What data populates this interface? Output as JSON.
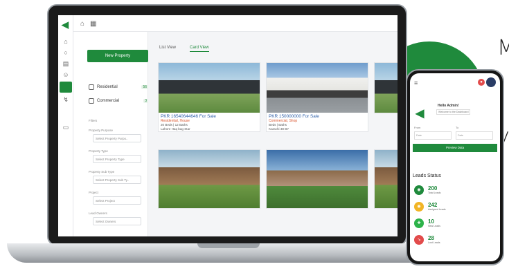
{
  "edge_text": {
    "line1": "M",
    "line2": "y"
  },
  "top_bar": {
    "home_icon": "home-icon",
    "building_icon": "building-icon"
  },
  "filter_panel": {
    "new_property": "New Property",
    "categories": [
      {
        "label": "Residential",
        "count": "56"
      },
      {
        "label": "Commercial",
        "count": "3"
      }
    ],
    "section_label": "Filters",
    "fields": [
      {
        "label": "Property Purpose",
        "placeholder": "Select Property Purpo.."
      },
      {
        "label": "Property Type",
        "placeholder": "Select Property Type"
      },
      {
        "label": "Property Sub Type",
        "placeholder": "Select Property Sub Ty.."
      },
      {
        "label": "Project",
        "placeholder": "Select Project"
      },
      {
        "label": "Lead Owners",
        "placeholder": "Select Owners"
      }
    ]
  },
  "tabs": {
    "list_view": "List View",
    "card_view": "Card View"
  },
  "cards": [
    {
      "price": "PKR 16540644646 For Sale",
      "type": "Residential, House",
      "details": "20 Beds | 12 Baths",
      "location": "Lahore Haq bag Star"
    },
    {
      "price": "PKR 150000000 For Sale",
      "type": "Commercial, Shop",
      "details": "Beds | Baths",
      "location": "Karachi 38 BY"
    },
    {
      "price": "",
      "type": "",
      "details": "",
      "location": ""
    },
    {
      "price": "",
      "type": "",
      "details": "",
      "location": ""
    }
  ],
  "phone": {
    "greeting": "Hello Admin!",
    "subtitle": "Welcome to the Dashboard",
    "from_label": "From",
    "to_label": "To",
    "from_value": "Date",
    "to_value": "Date",
    "apply_button": "Preview Data",
    "leads_title": "Leads Status",
    "leads": [
      {
        "value": "200",
        "label": "Total Leads",
        "color": "#1f8a3c"
      },
      {
        "value": "242",
        "label": "Assigned Leads",
        "color": "#f2b526"
      },
      {
        "value": "10",
        "label": "New Leads",
        "color": "#2db34a"
      },
      {
        "value": "28",
        "label": "Lost Leads",
        "color": "#e24b4b"
      }
    ]
  }
}
